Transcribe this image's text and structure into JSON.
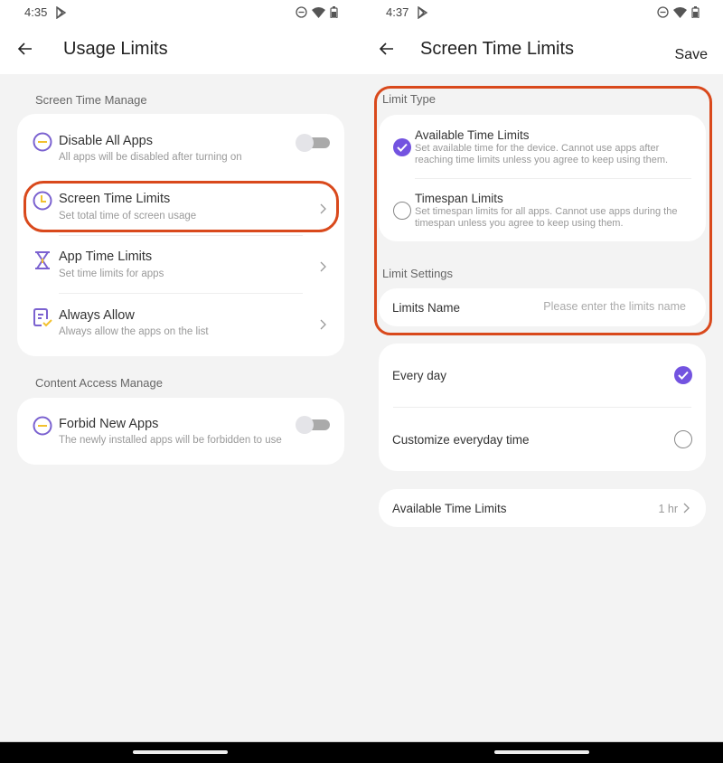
{
  "left_screen": {
    "status": {
      "time": "4:35"
    },
    "title": "Usage Limits",
    "sections": [
      {
        "label": "Screen Time Manage",
        "items": [
          {
            "title": "Disable All Apps",
            "subtitle": "All apps will be disabled after turning on",
            "icon": "minus-circle-icon",
            "control": "toggle",
            "toggle_on": false
          },
          {
            "title": "Screen Time Limits",
            "subtitle": "Set total time of screen usage",
            "icon": "clock-icon",
            "control": "chevron",
            "highlighted": true
          },
          {
            "title": "App Time Limits",
            "subtitle": "Set time limits for apps",
            "icon": "hourglass-icon",
            "control": "chevron"
          },
          {
            "title": "Always Allow",
            "subtitle": "Always allow the apps on the list",
            "icon": "checklist-icon",
            "control": "chevron"
          }
        ]
      },
      {
        "label": "Content Access Manage",
        "items": [
          {
            "title": "Forbid New Apps",
            "subtitle": "The newly installed apps will be forbidden to use",
            "icon": "minus-circle-icon",
            "control": "toggle",
            "toggle_on": false
          }
        ]
      }
    ]
  },
  "right_screen": {
    "status": {
      "time": "4:37"
    },
    "title": "Screen Time Limits",
    "save_label": "Save",
    "limit_type": {
      "label": "Limit Type",
      "options": [
        {
          "title": "Available Time Limits",
          "description": "Set available time for the device. Cannot use apps after reaching time limits unless you agree to keep using them.",
          "selected": true
        },
        {
          "title": "Timespan Limits",
          "description": "Set timespan limits for all apps. Cannot use apps during the timespan unless you agree to keep using them.",
          "selected": false
        }
      ]
    },
    "limit_settings": {
      "label": "Limit Settings",
      "name_label": "Limits Name",
      "name_value": "",
      "name_placeholder": "Please enter the limits name"
    },
    "schedule": [
      {
        "label": "Every day",
        "selected": true
      },
      {
        "label": "Customize everyday time",
        "selected": false
      }
    ],
    "available_time": {
      "label": "Available Time Limits",
      "value": "1 hr"
    }
  },
  "colors": {
    "accent": "#7353e0",
    "icon_purple": "#7b62d0",
    "icon_yellow": "#f2c12e",
    "highlight": "#d9491c"
  }
}
